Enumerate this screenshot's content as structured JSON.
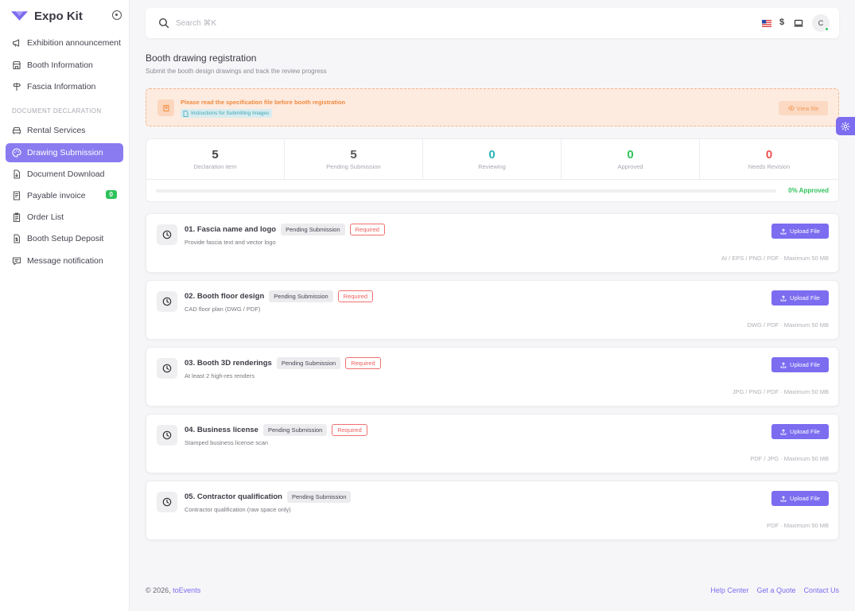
{
  "brand": {
    "name": "Expo Kit"
  },
  "sidebar": {
    "items": [
      {
        "label": "Exhibition announcement"
      },
      {
        "label": "Booth Information"
      },
      {
        "label": "Fascia Information"
      }
    ],
    "section_heading": "DOCUMENT DECLARATION",
    "section_items": [
      {
        "label": "Rental Services"
      },
      {
        "label": "Drawing Submission",
        "active": true
      },
      {
        "label": "Document Download"
      },
      {
        "label": "Payable invoice",
        "badge": "0"
      },
      {
        "label": "Order List"
      },
      {
        "label": "Booth Setup Deposit"
      },
      {
        "label": "Message notification"
      }
    ]
  },
  "topbar": {
    "search_placeholder": "Search ⌘K",
    "currency_symbol": "$",
    "avatar_initial": "C"
  },
  "page": {
    "title": "Booth drawing registration",
    "subtitle": "Submit the booth design drawings and track the review progress"
  },
  "notice": {
    "title": "Please read the specification file before booth registration",
    "link": "Instructions for Submitting Images",
    "button": "View file"
  },
  "stats": [
    {
      "value": "5",
      "label": "Declaration item",
      "color": "#444444"
    },
    {
      "value": "5",
      "label": "Pending Submission",
      "color": "#555555"
    },
    {
      "value": "0",
      "label": "Reviewing",
      "color": "#2ab5b5"
    },
    {
      "value": "0",
      "label": "Approved",
      "color": "#2fc25b"
    },
    {
      "value": "0",
      "label": "Needs Revision",
      "color": "#f05050"
    }
  ],
  "progress": {
    "label": "0% Approved",
    "fraction": 0
  },
  "items": [
    {
      "title": "01. Fascia name and logo",
      "status": "Pending Submission",
      "required": "Required",
      "desc": "Provide fascia text and vector logo",
      "formats": "AI / EPS / PNG / PDF · Maximum 50 MB",
      "button": "Upload File"
    },
    {
      "title": "02. Booth floor design",
      "status": "Pending Submission",
      "required": "Required",
      "desc": "CAD floor plan (DWG / PDF)",
      "formats": "DWG / PDF · Maximum 50 MB",
      "button": "Upload File"
    },
    {
      "title": "03. Booth 3D renderings",
      "status": "Pending Submission",
      "required": "Required",
      "desc": "At least 2 high-res renders",
      "formats": "JPG / PNG / PDF · Maximum 50 MB",
      "button": "Upload File"
    },
    {
      "title": "04. Business license",
      "status": "Pending Submission",
      "required": "Required",
      "desc": "Stamped business license scan",
      "formats": "PDF / JPG · Maximum 50 MB",
      "button": "Upload File"
    },
    {
      "title": "05. Contractor qualification",
      "status": "Pending Submission",
      "required": "",
      "desc": "Contractor qualification (raw space only)",
      "formats": "PDF · Maximum 50 MB",
      "button": "Upload File"
    }
  ],
  "footer": {
    "copyright": "© 2026,",
    "company": "toEvents",
    "links": [
      "Help Center",
      "Get a Quote",
      "Contact Us"
    ]
  },
  "colors": {
    "accent": "#7c6cf0",
    "success": "#2fc25b",
    "danger": "#f05050",
    "warning": "#f08a3e"
  }
}
